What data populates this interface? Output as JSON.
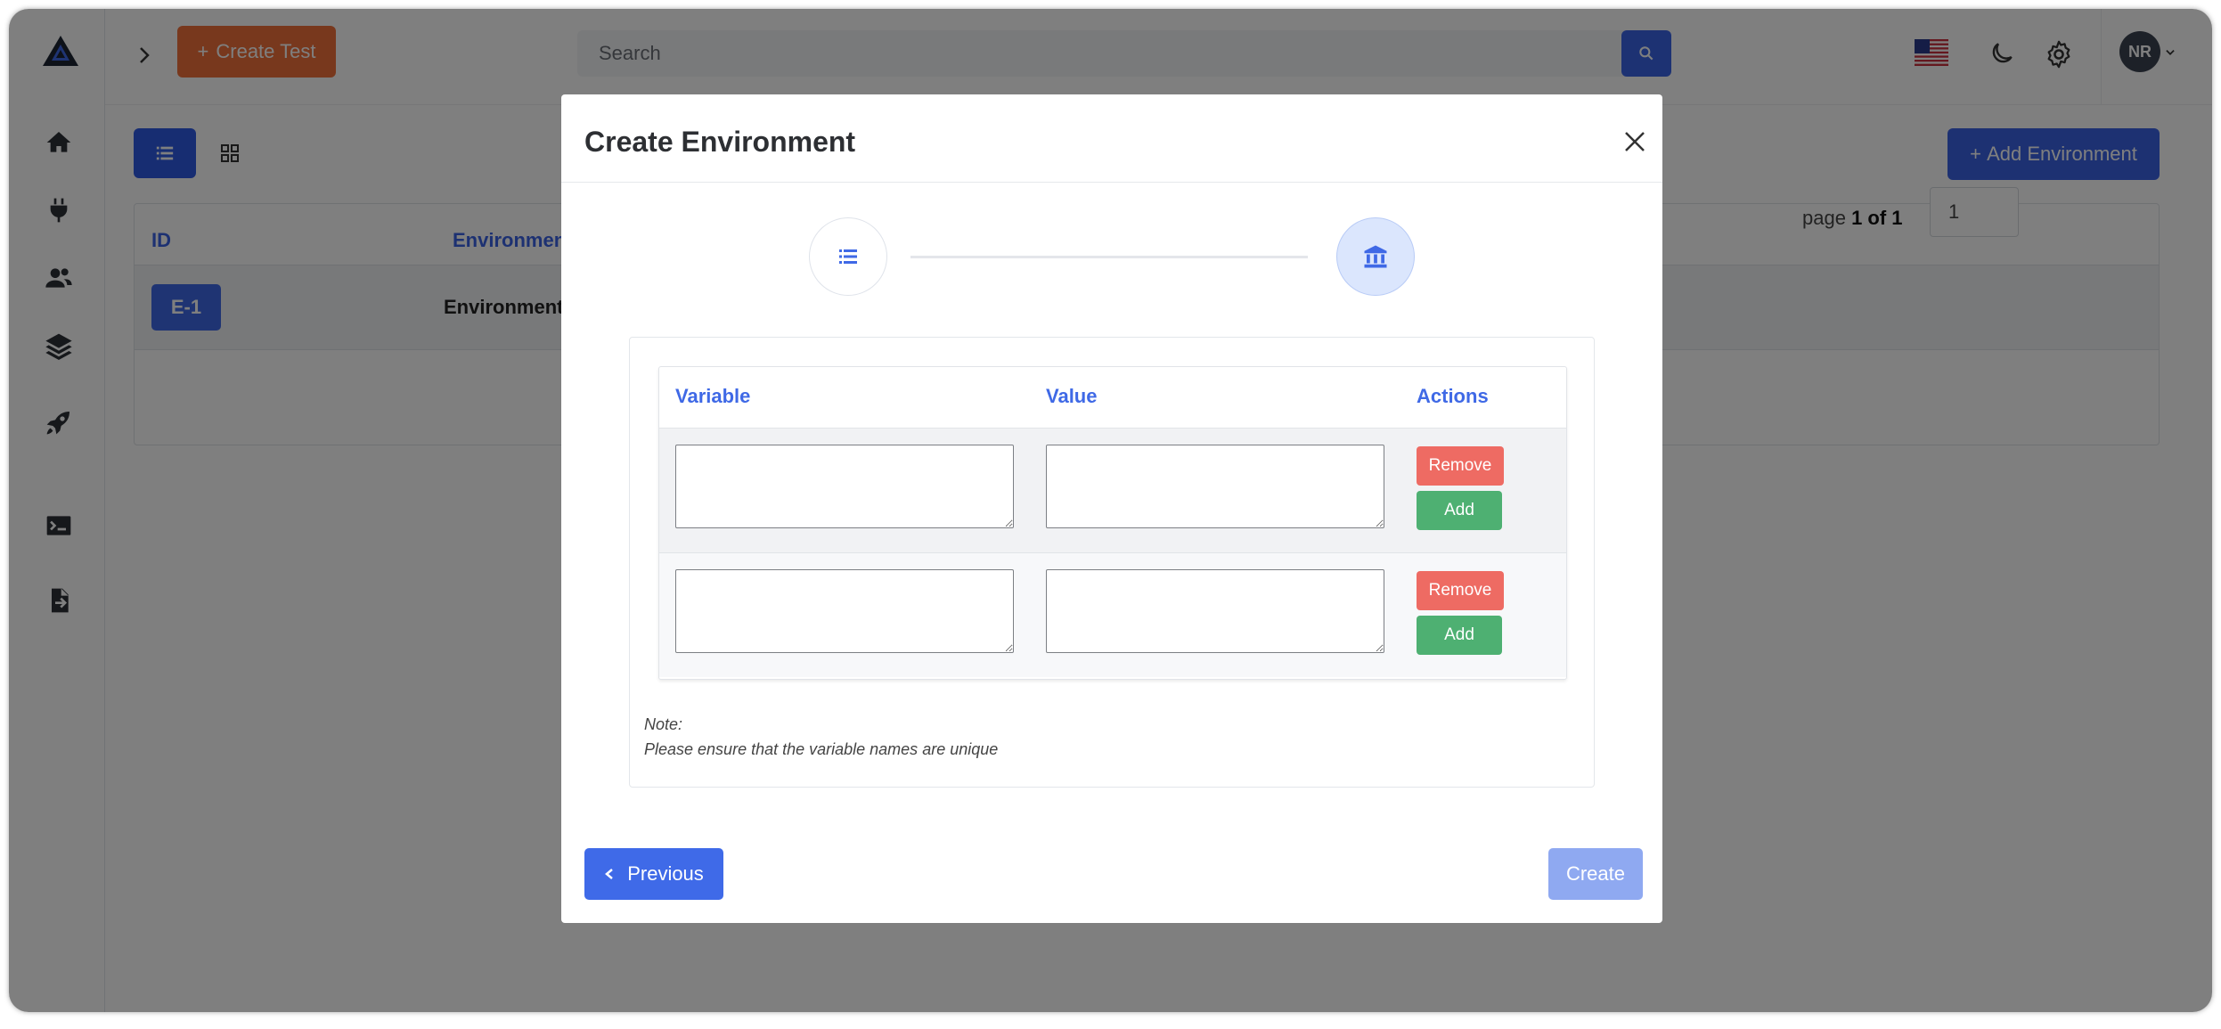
{
  "sidebar": {
    "items": [
      {
        "icon": "home-icon"
      },
      {
        "icon": "plug-icon"
      },
      {
        "icon": "users-icon"
      },
      {
        "icon": "layers-icon"
      },
      {
        "icon": "rocket-icon"
      },
      {
        "icon": "terminal-icon"
      },
      {
        "icon": "file-import-icon"
      }
    ]
  },
  "topbar": {
    "create_test_label": "Create Test",
    "search_placeholder": "Search",
    "avatar_initials": "NR"
  },
  "content": {
    "add_environment_label": "Add Environment",
    "table": {
      "headers": [
        "ID",
        "Environment"
      ],
      "rows": [
        {
          "id": "E-1",
          "name": "Environment"
        }
      ]
    },
    "pagination": {
      "prefix": "page ",
      "current_of_total": "1 of 1",
      "input_value": "1"
    }
  },
  "modal": {
    "title": "Create Environment",
    "table_headers": {
      "variable": "Variable",
      "value": "Value",
      "actions": "Actions"
    },
    "rows": [
      {
        "variable": "",
        "value": "",
        "remove_label": "Remove",
        "add_label": "Add"
      },
      {
        "variable": "",
        "value": "",
        "remove_label": "Remove",
        "add_label": "Add"
      }
    ],
    "note_title": "Note:",
    "note_text": "Please ensure that the variable names are unique",
    "previous_label": "Previous",
    "create_label": "Create"
  },
  "colors": {
    "primary": "#3f69e6",
    "create_test": "#f0713a",
    "remove": "#ee6b63",
    "add": "#4eb072",
    "create_disabled": "#8fa9f1"
  }
}
